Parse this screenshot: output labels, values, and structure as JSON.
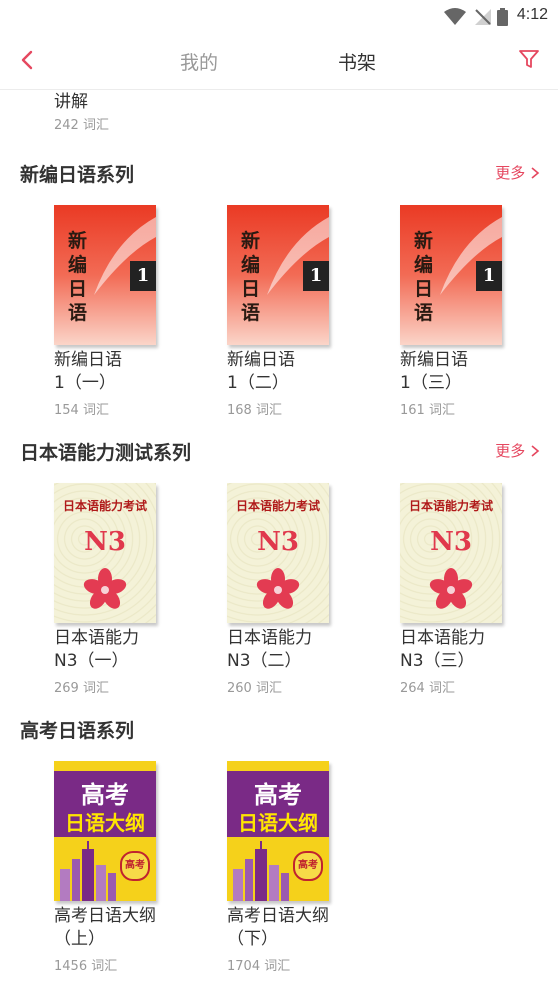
{
  "status_bar": {
    "time": "4:12"
  },
  "nav": {
    "tab_mine": "我的",
    "tab_shelf": "书架"
  },
  "partial_item": {
    "title": "讲解",
    "count": "242 词汇"
  },
  "sections": [
    {
      "title": "新编日语系列",
      "more": "更多",
      "books": [
        {
          "title_line1": "新编日语",
          "title_line2": "1（一）",
          "count": "154 词汇",
          "cover_text": "新编日语",
          "cover_badge": "1"
        },
        {
          "title_line1": "新编日语",
          "title_line2": "1（二）",
          "count": "168 词汇",
          "cover_text": "新编日语",
          "cover_badge": "1"
        },
        {
          "title_line1": "新编日语",
          "title_line2": "1（三）",
          "count": "161 词汇",
          "cover_text": "新编日语",
          "cover_badge": "1"
        }
      ]
    },
    {
      "title": "日本语能力测试系列",
      "more": "更多",
      "books": [
        {
          "title_line1": "日本语能力",
          "title_line2": "N3（一）",
          "count": "269 词汇",
          "cover_header": "日本语能力考试",
          "cover_level": "N3"
        },
        {
          "title_line1": "日本语能力",
          "title_line2": "N3（二）",
          "count": "260 词汇",
          "cover_header": "日本语能力考试",
          "cover_level": "N3"
        },
        {
          "title_line1": "日本语能力",
          "title_line2": "N3（三）",
          "count": "264 词汇",
          "cover_header": "日本语能力考试",
          "cover_level": "N3"
        }
      ]
    },
    {
      "title": "高考日语系列",
      "books": [
        {
          "title_line1": "高考日语大纲",
          "title_line2": "（上）",
          "count": "1456 词汇",
          "cover_top": "高考",
          "cover_bottom": "日语大纲",
          "cover_seal": "高考"
        },
        {
          "title_line1": "高考日语大纲",
          "title_line2": "（下）",
          "count": "1704 词汇",
          "cover_top": "高考",
          "cover_bottom": "日语大纲",
          "cover_seal": "高考"
        }
      ]
    }
  ],
  "colors": {
    "accent": "#e5475f",
    "nav_text": "#333333",
    "muted": "#999999"
  }
}
